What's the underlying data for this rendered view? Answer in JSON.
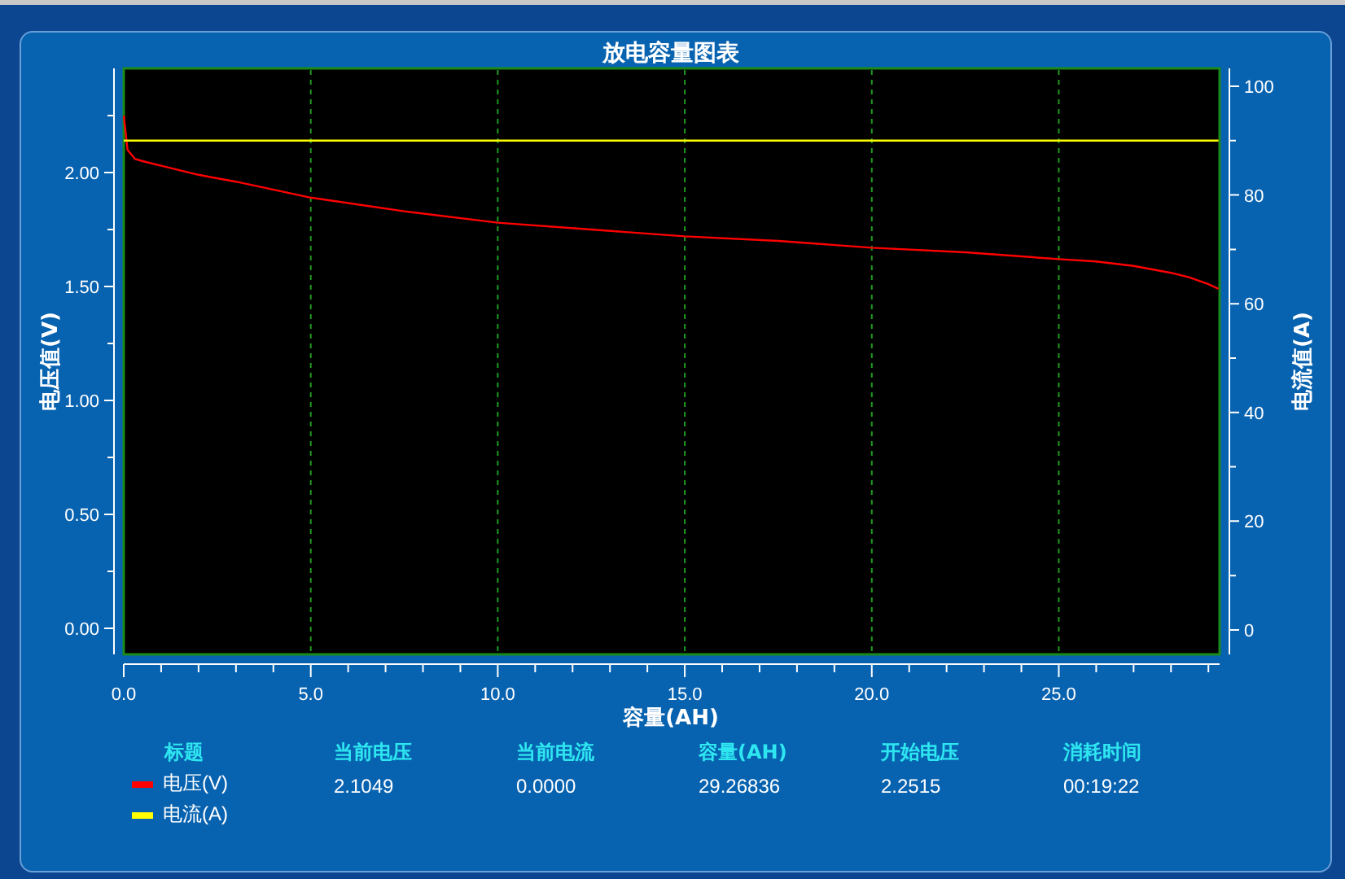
{
  "chart": {
    "chart_data": {
      "type": "line",
      "title": "放电容量图表",
      "xlabel": "容量(AH)",
      "ylabel": "电压值(V)",
      "y2label": "电流值(A)",
      "x": [
        0,
        0.1,
        0.3,
        0.5,
        1,
        2,
        3,
        5,
        7.5,
        10,
        12.5,
        15,
        17.5,
        20,
        22.5,
        25,
        26,
        27,
        28,
        28.5,
        29,
        29.27
      ],
      "series": [
        {
          "name": "电压(V)",
          "color": "#ff0000",
          "values": [
            2.25,
            2.1,
            2.06,
            2.05,
            2.03,
            1.99,
            1.96,
            1.89,
            1.83,
            1.78,
            1.75,
            1.72,
            1.7,
            1.67,
            1.65,
            1.62,
            1.61,
            1.59,
            1.56,
            1.54,
            1.51,
            1.49
          ]
        },
        {
          "name": "电流(A)",
          "color": "#ffff00",
          "axis": "y2",
          "values": [
            90,
            90,
            90,
            90,
            90,
            90,
            90,
            90,
            90,
            90,
            90,
            90,
            90,
            90,
            90,
            90,
            90,
            90,
            90,
            90,
            90,
            90
          ]
        }
      ],
      "xlim": [
        0,
        29.3
      ],
      "ylim": [
        -0.114,
        2.457
      ],
      "y2lim": [
        -4.5,
        103.3
      ],
      "xticks": [
        {
          "value": 0,
          "label": "0.0"
        },
        {
          "value": 5,
          "label": "5.0"
        },
        {
          "value": 10,
          "label": "10.0"
        },
        {
          "value": 15,
          "label": "15.0"
        },
        {
          "value": 20,
          "label": "20.0"
        },
        {
          "value": 25,
          "label": "25.0"
        }
      ],
      "yticks": [
        {
          "value": 0,
          "label": "0.00"
        },
        {
          "value": 0.5,
          "label": "0.50"
        },
        {
          "value": 1,
          "label": "1.00"
        },
        {
          "value": 1.5,
          "label": "1.50"
        },
        {
          "value": 2,
          "label": "2.00"
        }
      ],
      "y2ticks": [
        0,
        20,
        40,
        60,
        80,
        100
      ],
      "grid": "x"
    }
  },
  "legend": {
    "title": "标题"
  },
  "stats": [
    {
      "label": "当前电压",
      "value": "2.1049"
    },
    {
      "label": "当前电流",
      "value": "0.0000"
    },
    {
      "label": "容量(AH)",
      "value": "29.26836"
    },
    {
      "label": "开始电压",
      "value": "2.2515"
    },
    {
      "label": "消耗时间",
      "value": "00:19:22"
    }
  ]
}
